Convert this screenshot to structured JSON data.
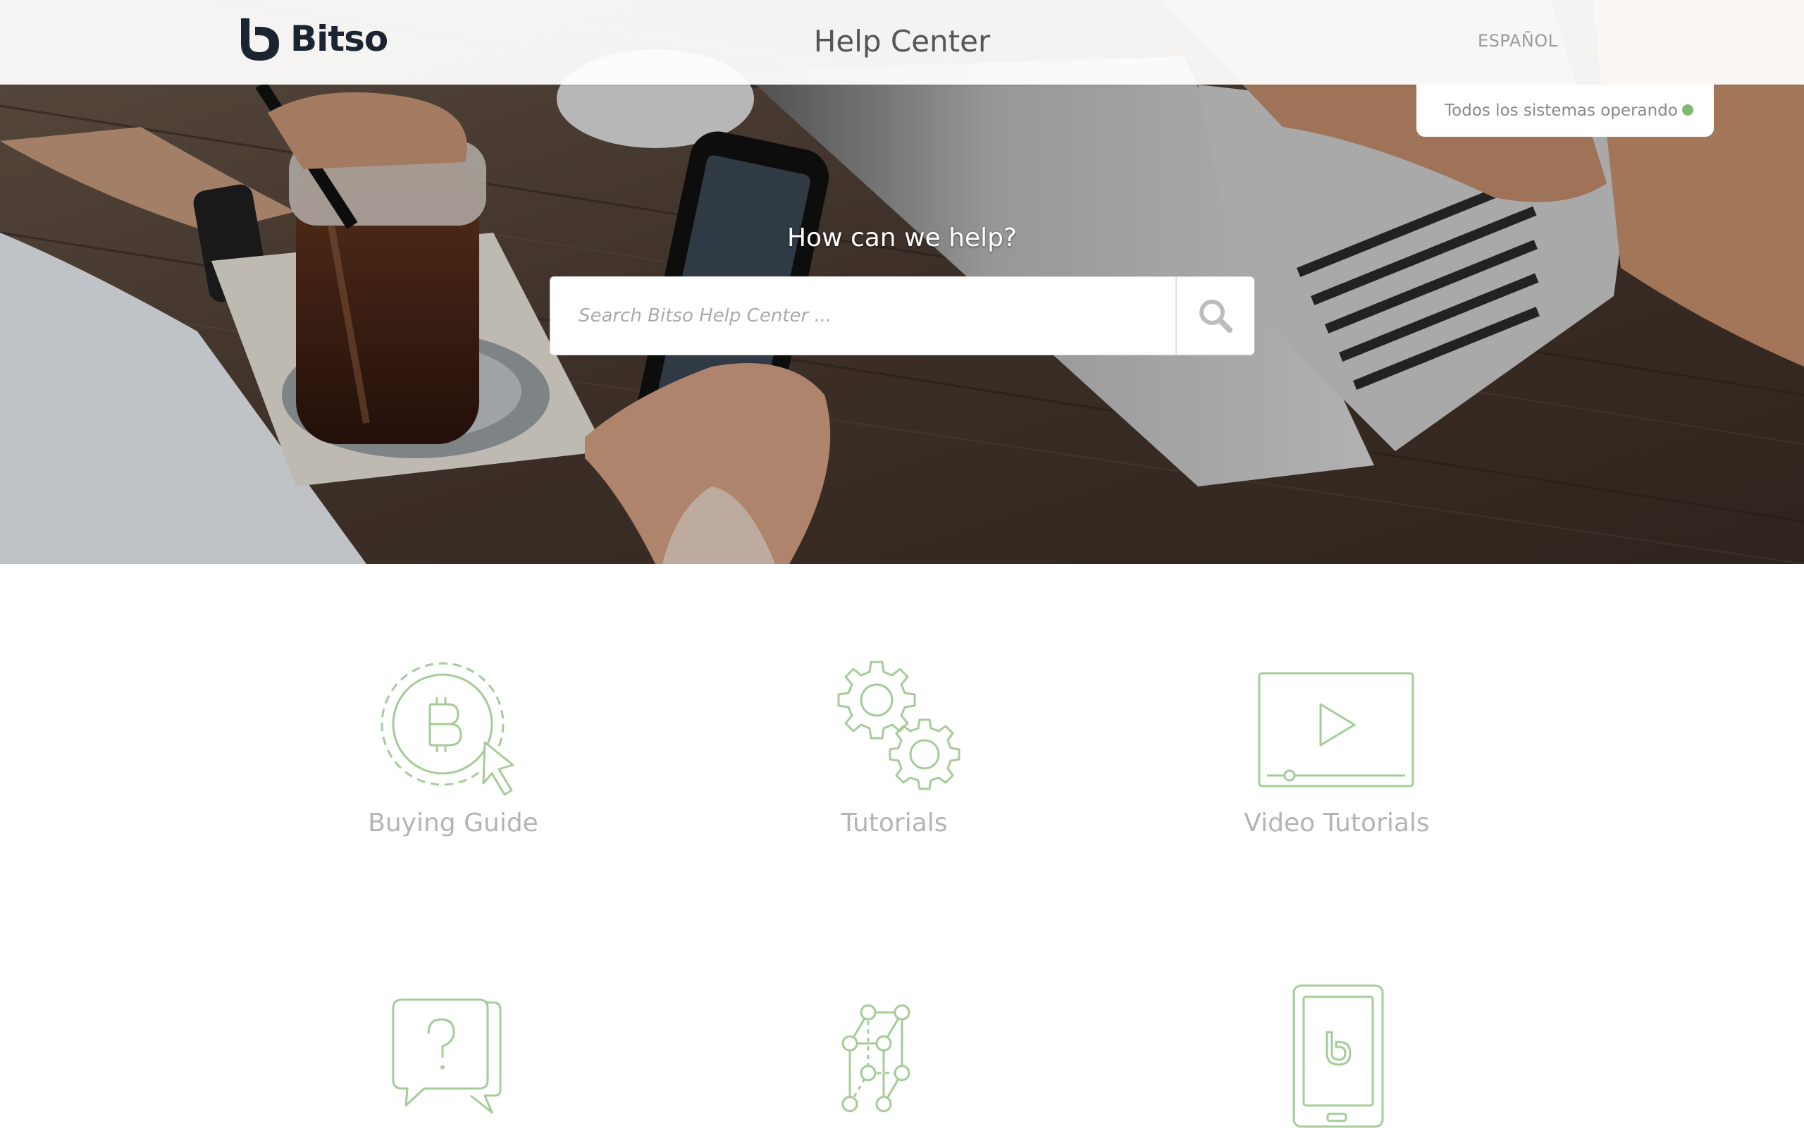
{
  "header": {
    "brand": "Bitso",
    "title": "Help Center",
    "language_link": "ESPAÑOL"
  },
  "status": {
    "text": "Todos los sistemas operando",
    "dot_color": "#7eb871"
  },
  "hero": {
    "question": "How can we help?"
  },
  "search": {
    "placeholder": "Search Bitso Help Center ...",
    "button_icon": "search-icon"
  },
  "categories": [
    {
      "label": "Buying Guide",
      "icon": "bitcoin-cursor-icon"
    },
    {
      "label": "Tutorials",
      "icon": "gears-icon"
    },
    {
      "label": "Video Tutorials",
      "icon": "video-player-icon"
    },
    {
      "label": "",
      "icon": "question-chat-icon"
    },
    {
      "label": "",
      "icon": "network-cube-icon"
    },
    {
      "label": "",
      "icon": "mobile-app-icon"
    }
  ],
  "colors": {
    "accent": "#a4cc98",
    "brand_dark": "#1b2532",
    "label_gray": "#b4b4b4"
  }
}
